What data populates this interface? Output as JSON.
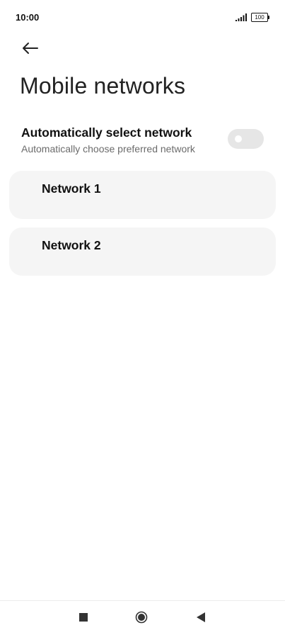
{
  "status_bar": {
    "time": "10:00",
    "battery_level": "100",
    "icons": [
      "signal-icon",
      "battery-icon"
    ]
  },
  "header": {
    "back_icon": "arrow-left-icon",
    "title": "Mobile networks"
  },
  "auto_select": {
    "title": "Automatically select network",
    "subtitle": "Automatically choose preferred network",
    "enabled": false
  },
  "networks": [
    {
      "label": "Network 1"
    },
    {
      "label": "Network 2"
    }
  ],
  "nav_bar": {
    "icons": [
      "recents-icon",
      "home-icon",
      "back-icon"
    ]
  },
  "colors": {
    "background": "#ffffff",
    "card": "#f5f5f5",
    "toggle_off": "#e6e6e6",
    "subtitle": "#6b6b6b"
  }
}
